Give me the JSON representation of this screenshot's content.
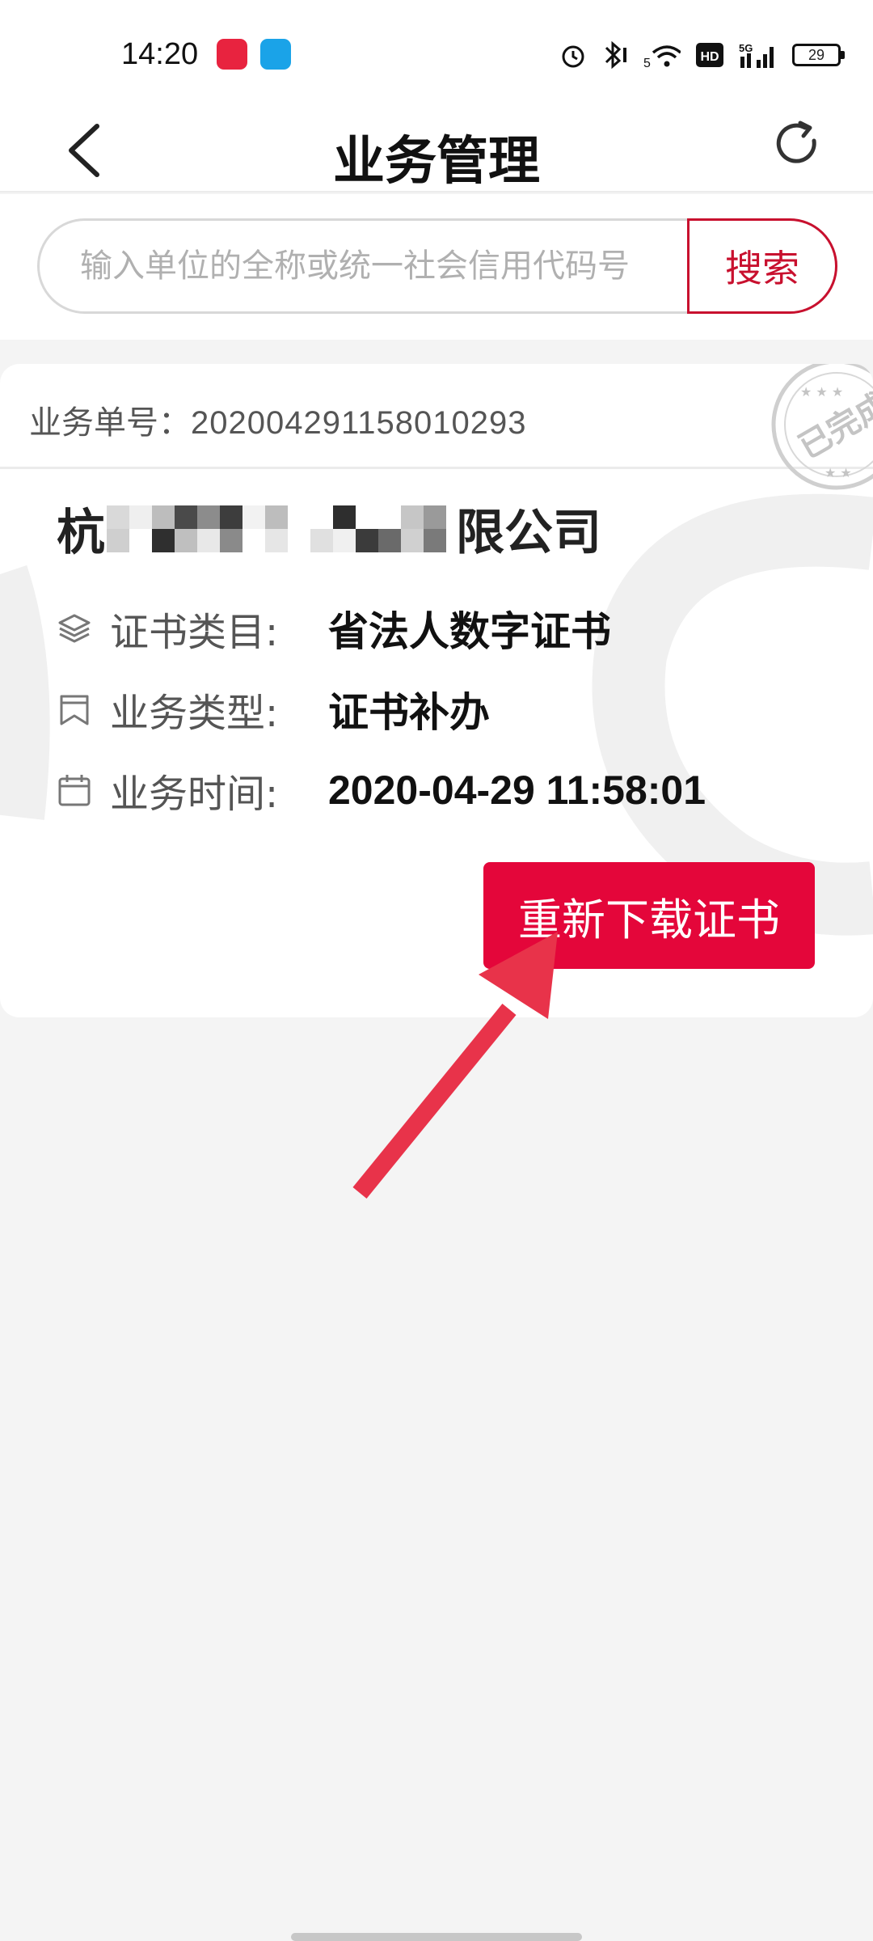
{
  "status_bar": {
    "time": "14:20",
    "battery": "29",
    "network": "5G",
    "hd_label": "HD",
    "icons": [
      "alarm-icon",
      "bluetooth-icon",
      "wifi-icon",
      "hd-icon",
      "signal-icon",
      "battery-icon"
    ]
  },
  "header": {
    "title": "业务管理",
    "back_icon": "chevron-left-icon",
    "refresh_icon": "refresh-icon"
  },
  "search": {
    "placeholder": "输入单位的全称或统一社会信用代码号",
    "value": "",
    "button_label": "搜索"
  },
  "record": {
    "order_label": "业务单号：",
    "order_number": "202004291158010293",
    "stamp_text": "已完成",
    "company_prefix": "杭",
    "company_suffix": "限公司",
    "fields": [
      {
        "icon": "layers-icon",
        "label": "证书类目:",
        "value": "省法人数字证书"
      },
      {
        "icon": "bookmark-icon",
        "label": "业务类型:",
        "value": "证书补办"
      },
      {
        "icon": "calendar-icon",
        "label": "业务时间:",
        "value": "2020-04-29 11:58:01"
      }
    ],
    "redownload_label": "重新下载证书"
  },
  "colors": {
    "accent": "#e4063a",
    "search_red": "#c8102e",
    "annotation_arrow": "#e8334a"
  }
}
